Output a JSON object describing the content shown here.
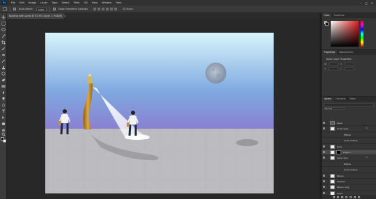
{
  "menu": {
    "app_icon": "Ps",
    "items": [
      "File",
      "Edit",
      "Image",
      "Layer",
      "Type",
      "Select",
      "Filter",
      "3D",
      "View",
      "Window",
      "Help"
    ]
  },
  "options_bar": {
    "auto_select_label": "Auto-Select:",
    "auto_select_target": "Layer",
    "show_transform_label": "Show Transform Controls",
    "mode_3d_label": "3D Mode:"
  },
  "document_tab": {
    "title": "Building with Lamp @ 33.3% (Layer 1, RGB/8)",
    "close": "×"
  },
  "color_panel": {
    "tabs": [
      "Color",
      "Swatches"
    ]
  },
  "properties_panel": {
    "tabs": [
      "Properties",
      "Adjustments"
    ],
    "title": "Smart Layer Properties",
    "fields": [
      {
        "label": "W",
        "value": ""
      },
      {
        "label": "H",
        "value": ""
      },
      {
        "label": "X",
        "value": ""
      },
      {
        "label": "Y",
        "value": ""
      }
    ]
  },
  "layers_panel": {
    "tabs": [
      "Layers",
      "Channels",
      "Paths"
    ],
    "blend_mode": "Normal",
    "layers": [
      {
        "name": "Lamp",
        "kind": "group",
        "fx": false
      },
      {
        "name": "Color Layer",
        "kind": "layer",
        "fx": true
      },
      {
        "name": "Effects",
        "kind": "sub",
        "fx": false
      },
      {
        "name": "Color Overlay",
        "kind": "sub",
        "fx": false
      },
      {
        "name": "Glow",
        "kind": "layer",
        "fx": false
      },
      {
        "name": "Layer 1",
        "kind": "layer",
        "fx": false,
        "selected": true,
        "mask": true
      },
      {
        "name": "Lamp copy",
        "kind": "layer",
        "fx": true
      },
      {
        "name": "Effects",
        "kind": "sub",
        "fx": false
      },
      {
        "name": "Color Overlay",
        "kind": "sub",
        "fx": false
      },
      {
        "name": "Person",
        "kind": "layer",
        "fx": false
      },
      {
        "name": "Shadow",
        "kind": "layer",
        "fx": false
      },
      {
        "name": "Person copy",
        "kind": "layer",
        "fx": false
      },
      {
        "name": "Layer",
        "kind": "layer",
        "fx": false
      }
    ]
  },
  "colors": {
    "sky_top": "#d8f4fb",
    "sky_mid": "#7fa9e0",
    "sky_bottom": "#8a7fd0",
    "ground": "#b9b9bd",
    "lamp_post": "#c98f2a",
    "light_beam": "#ffffff"
  },
  "icons": [
    "move-icon",
    "marquee-icon",
    "lasso-icon",
    "quick-select-icon",
    "crop-icon",
    "eyedropper-icon",
    "healing-icon",
    "brush-icon",
    "clone-stamp-icon",
    "history-brush-icon",
    "eraser-icon",
    "gradient-icon",
    "blur-icon",
    "dodge-icon",
    "pen-icon",
    "type-icon",
    "path-select-icon",
    "rectangle-icon",
    "hand-icon",
    "zoom-icon"
  ]
}
